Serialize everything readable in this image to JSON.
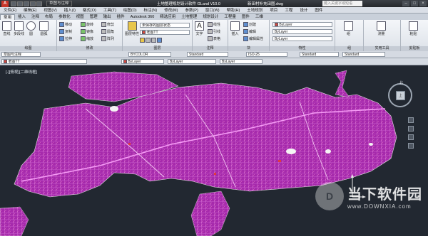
{
  "titlebar": {
    "workspace": "草图与注释",
    "title": "土地整理规划设计软件 GLand V10.0",
    "filename": "新田村补充田图.dwg",
    "search_placeholder": "键入关键字或短语"
  },
  "menu": [
    "文件(F)",
    "编辑(E)",
    "视图(V)",
    "插入(I)",
    "格式(O)",
    "工具(T)",
    "绘图(D)",
    "标注(N)",
    "修改(M)",
    "参数(P)",
    "窗口(W)",
    "帮助(H)",
    "土地规划",
    "项目",
    "工程",
    "设计",
    "图件",
    "三维",
    "视图工具"
  ],
  "tabs": [
    "常用",
    "插入",
    "注释",
    "布局",
    "参数化",
    "视图",
    "管理",
    "输出",
    "插件",
    "Autodesk 360",
    "精选应用",
    "土地整理",
    "规划设计",
    "工程量",
    "图件",
    "三维",
    "模型"
  ],
  "active_tab": "常用",
  "ribbon": {
    "draw": {
      "title": "绘图",
      "line": "直线",
      "polyline": "多段线",
      "circle": "圆",
      "arc": "圆弧"
    },
    "modify": {
      "title": "修改",
      "move": "移动",
      "rotate": "旋转",
      "trim": "修剪",
      "copy": "复制",
      "mirror": "镜像",
      "fillet": "圆角",
      "stretch": "拉伸",
      "scale": "缩放",
      "array": "阵列"
    },
    "layers": {
      "title": "图层",
      "layer_props": "图层特性",
      "unsaved_state": "未保存的图层状态",
      "current_layer": "老图TT"
    },
    "annotation": {
      "title": "注释",
      "text": "文字",
      "linear": "线性",
      "leader": "引线",
      "table": "表格"
    },
    "block": {
      "title": "块",
      "create": "创建",
      "insert": "插入",
      "edit": "编辑",
      "edit_attr": "编辑属性"
    },
    "properties": {
      "title": "特性",
      "color": "ByLayer",
      "linetype": "ByLayer",
      "lineweight": "ByLayer"
    },
    "groups": {
      "title": "组",
      "group": "组"
    },
    "utilities": {
      "title": "实用工具",
      "measure": "测量"
    },
    "clipboard": {
      "title": "剪贴板",
      "paste": "粘贴"
    }
  },
  "propbar1": {
    "workspace": "草图与注释",
    "color": "ByLayer",
    "linetype": "ByLayer",
    "lineweight": "ByLayer",
    "plotstyle": "BYCOLOR",
    "textstyle": "Standard",
    "dimstyle": "ISO-25",
    "tablestyle": "Standard"
  },
  "propbar2": {
    "layer": "老图TT",
    "color": "ByLayer",
    "linetype": "ByLayer",
    "lineweight": "ByLayer"
  },
  "viewport_label": "[-][俯视][二维线框]",
  "viewcube": {
    "face": "上",
    "north": "北"
  },
  "watermark": {
    "cn": "当下软件园",
    "en": "www.DOWNXIA.com"
  },
  "colors": {
    "map_fill": "#b52fb8",
    "background": "#222831",
    "road": "#f07cf0"
  }
}
